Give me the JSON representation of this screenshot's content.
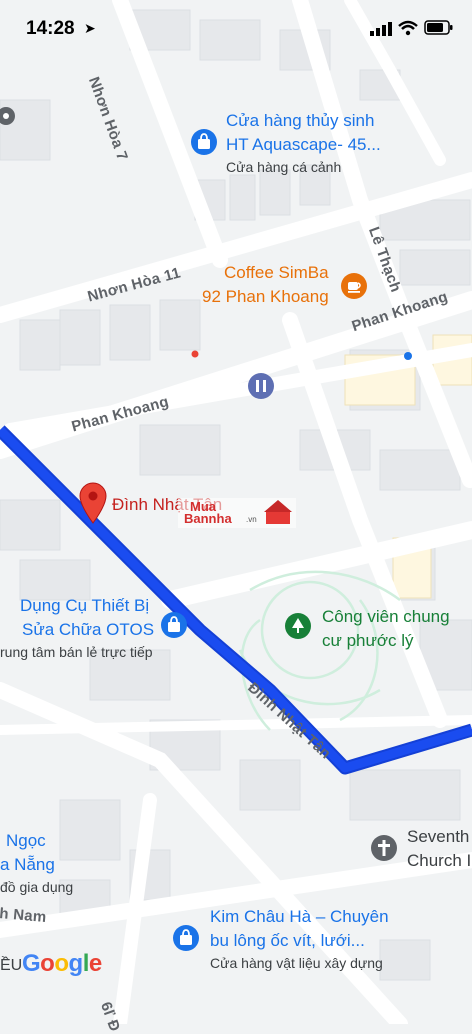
{
  "status_bar": {
    "time": "14:28"
  },
  "pois": {
    "aquascape": {
      "name_line1": "Cửa hàng thủy sinh",
      "name_line2": "HT Aquascape- 45...",
      "category": "Cửa hàng cá cảnh"
    },
    "coffee": {
      "name_line1": "Coffee SimBa",
      "name_line2": "92 Phan Khoang"
    },
    "dinh": {
      "name": "Đình Nhật Tân"
    },
    "otos": {
      "name_line1": "Dụng Cụ Thiết Bị",
      "name_line2": "Sửa Chữa OTOS",
      "category": "rung tâm bán lẻ trực tiếp"
    },
    "park": {
      "name_line1": "Công viên chung",
      "name_line2": "cư phước lý"
    },
    "church": {
      "name_line1": "Seventh",
      "name_line2": "Church I"
    },
    "kimchau": {
      "name_line1": "Kim Châu Hà – Chuyên",
      "name_line2": "bu lông ốc vít, lưới...",
      "category": "Cửa hàng vật liệu xây dựng"
    },
    "ngoc": {
      "name_line1": "Ngọc",
      "name_line2": "a Nẵng",
      "category": "đồ gia dụng"
    }
  },
  "streets": {
    "nhon_hoa_7": "Nhơn Hòa 7",
    "nhon_hoa_11": "Nhơn Hòa 11",
    "le_thach": "Lê Thạch",
    "phan_khoang_1": "Phan Khoang",
    "phan_khoang_2": "Phan Khoang",
    "dinh_nhat_tan": "Đình Nhật Tân",
    "nam": "h Nam",
    "bottom": "6ľ Đ"
  },
  "watermark": {
    "line1": "Mua",
    "line2": "Bannha",
    "suffix": ".vn"
  },
  "map_brand": {
    "prefix": "ỀU",
    "letters": [
      "G",
      "o",
      "o",
      "g",
      "l",
      "e"
    ]
  },
  "colors": {
    "route": "#1a4cf0",
    "pin": "#ea4335",
    "poi_blue": "#1a73e8",
    "park_green": "#188038",
    "coffee_orange": "#e8710a"
  },
  "icons": {
    "aquascape": "shopping-bag-icon",
    "coffee": "coffee-cup-icon",
    "restroom": "restroom-icon",
    "otos": "shopping-bag-icon",
    "park": "tree-icon",
    "church": "cross-icon",
    "kimchau": "shopping-bag-icon",
    "settings": "gear-icon"
  }
}
